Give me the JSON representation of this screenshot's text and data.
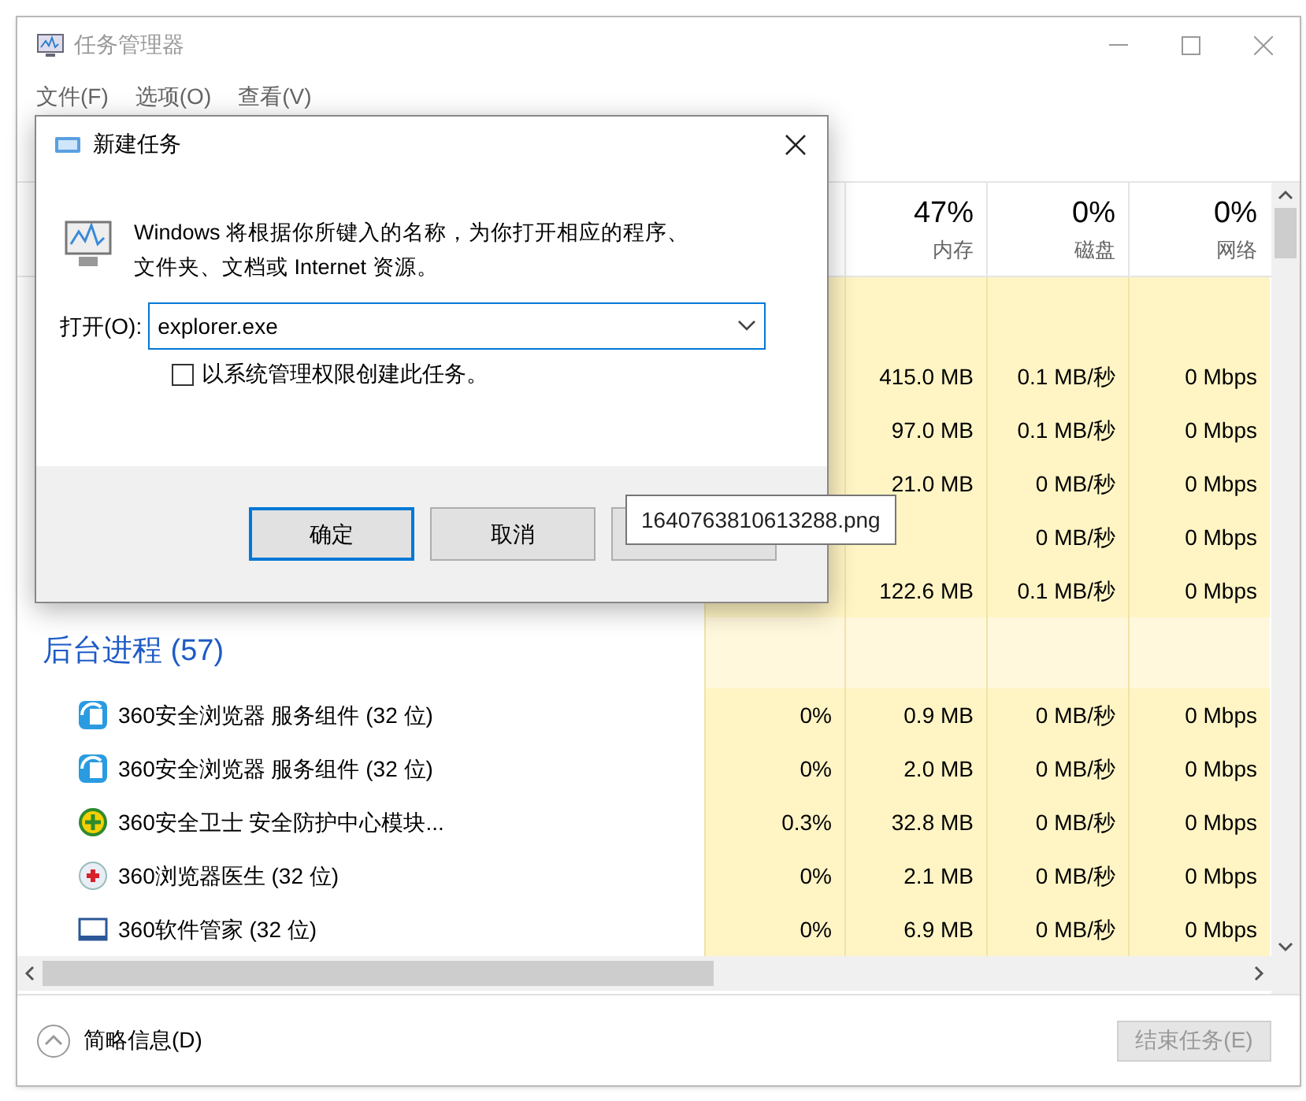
{
  "window": {
    "title": "任务管理器"
  },
  "menu": [
    "文件(F)",
    "选项(O)",
    "查看(V)"
  ],
  "columns": [
    {
      "percent": "47%",
      "label": "内存"
    },
    {
      "percent": "0%",
      "label": "磁盘"
    },
    {
      "percent": "0%",
      "label": "网络"
    }
  ],
  "app_rows": [
    {
      "memory": "415.0 MB",
      "disk": "0.1 MB/秒",
      "network": "0 Mbps"
    },
    {
      "memory": "97.0 MB",
      "disk": "0.1 MB/秒",
      "network": "0 Mbps"
    },
    {
      "memory": "21.0 MB",
      "disk": "0 MB/秒",
      "network": "0 Mbps"
    },
    {
      "disk": "0 MB/秒",
      "network": "0 Mbps"
    },
    {
      "memory": "122.6 MB",
      "disk": "0.1 MB/秒",
      "network": "0 Mbps"
    }
  ],
  "background": {
    "title": "后台进程 (57)",
    "rows": [
      {
        "kind": "service",
        "name": "360安全浏览器 服务组件 (32 位)",
        "cpu": "0%",
        "memory": "0.9 MB",
        "disk": "0 MB/秒",
        "network": "0 Mbps"
      },
      {
        "kind": "service",
        "name": "360安全浏览器 服务组件 (32 位)",
        "cpu": "0%",
        "memory": "2.0 MB",
        "disk": "0 MB/秒",
        "network": "0 Mbps"
      },
      {
        "kind": "guard",
        "name": "360安全卫士 安全防护中心模块...",
        "cpu": "0.3%",
        "memory": "32.8 MB",
        "disk": "0 MB/秒",
        "network": "0 Mbps"
      },
      {
        "kind": "doctor",
        "name": "360浏览器医生 (32 位)",
        "cpu": "0%",
        "memory": "2.1 MB",
        "disk": "0 MB/秒",
        "network": "0 Mbps"
      },
      {
        "kind": "window",
        "name": "360软件管家 (32 位)",
        "cpu": "0%",
        "memory": "6.9 MB",
        "disk": "0 MB/秒",
        "network": "0 Mbps"
      }
    ]
  },
  "footer": {
    "details": "简略信息(D)",
    "end_task": {
      "label": "结束任务(E)",
      "disabled": true
    }
  },
  "dialog": {
    "title": "新建任务",
    "message": "Windows 将根据你所键入的名称，为你打开相应的程序、文件夹、文档或 Internet 资源。",
    "open_label": "打开(O):",
    "value": "explorer.exe",
    "admin": {
      "label": "以系统管理权限创建此任务。",
      "checked": false
    },
    "buttons": [
      {
        "label": "确定",
        "default": true
      },
      {
        "label": "取消",
        "default": false
      }
    ]
  },
  "tooltip": "1640763810613288.png"
}
